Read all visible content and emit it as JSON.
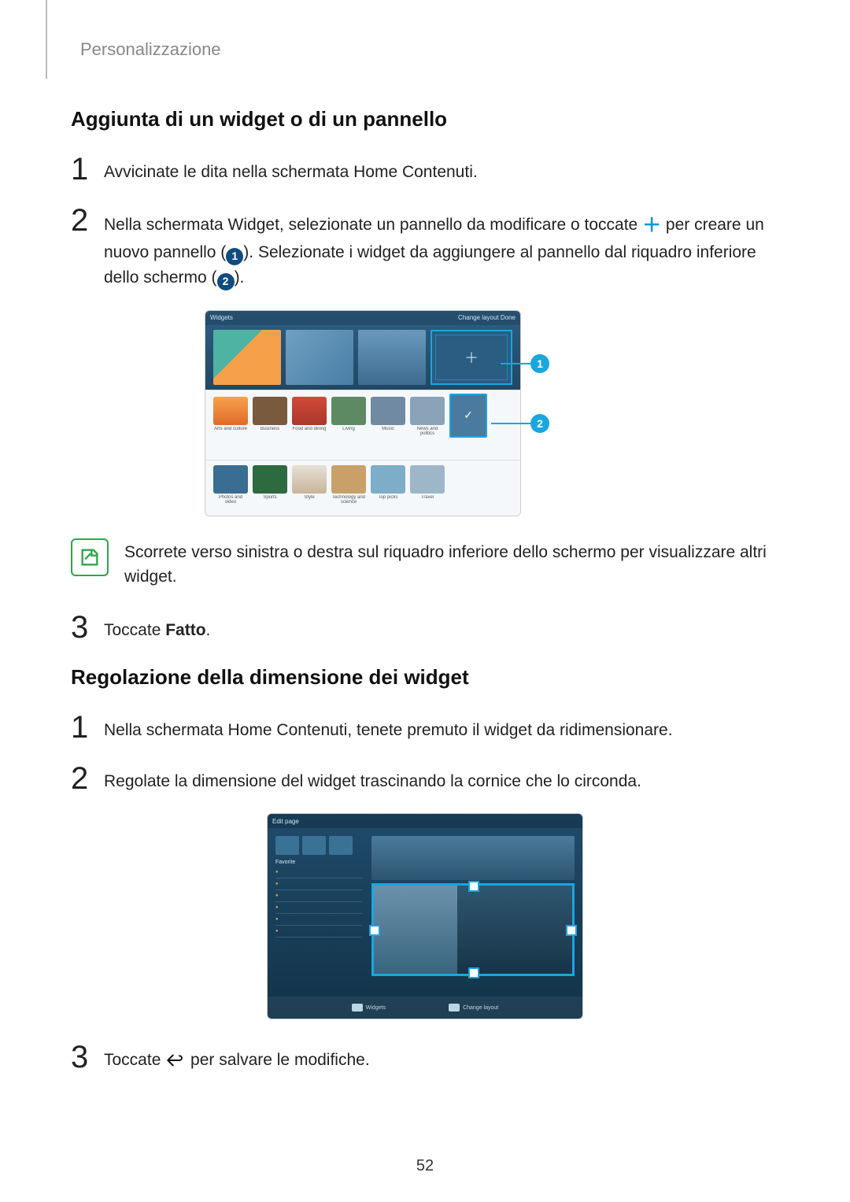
{
  "breadcrumb": "Personalizzazione",
  "section_a": {
    "title": "Aggiunta di un widget o di un pannello",
    "step1": "Avvicinate le dita nella schermata Home Contenuti.",
    "step2_a": "Nella schermata Widget, selezionate un pannello da modificare o toccate ",
    "step2_b": " per creare un nuovo pannello (",
    "step2_c": "). Selezionate i widget da aggiungere al pannello dal riquadro inferiore dello schermo (",
    "step2_d": ").",
    "note": "Scorrete verso sinistra o destra sul riquadro inferiore dello schermo per visualizzare altri widget.",
    "step3_a": "Toccate ",
    "step3_bold": "Fatto",
    "step3_b": "."
  },
  "section_b": {
    "title": "Regolazione della dimensione dei widget",
    "step1": "Nella schermata Home Contenuti, tenete premuto il widget da ridimensionare.",
    "step2": "Regolate la dimensione del widget trascinando la cornice che lo circonda.",
    "step3_a": "Toccate ",
    "step3_b": " per salvare le modifiche."
  },
  "fig1": {
    "topbar_left": "Widgets",
    "topbar_right": "Change layout    Done",
    "callout1": "1",
    "callout2": "2",
    "row1_labels": [
      "Arts and culture",
      "Business",
      "Food and dining",
      "Living",
      "Music",
      "News and politics"
    ],
    "row2_labels": [
      "Photos and video",
      "Sports",
      "Style",
      "Technology and science",
      "Top picks",
      "Travel"
    ]
  },
  "fig2": {
    "topbar_left": "Edit page",
    "side_header": "Favorite",
    "bottom_left": "Widgets",
    "bottom_right": "Change layout"
  },
  "nums": {
    "n1": "1",
    "n2": "2",
    "n3": "3"
  },
  "page_number": "52"
}
